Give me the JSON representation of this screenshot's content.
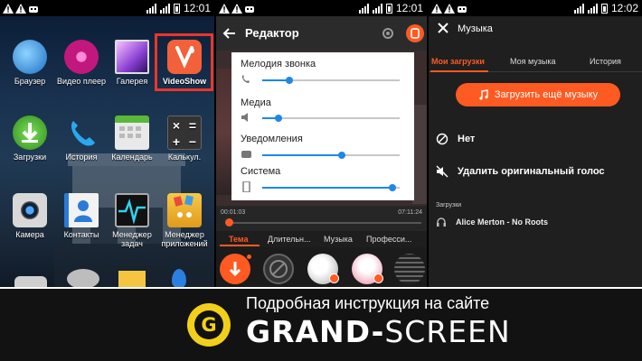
{
  "status_bars": [
    {
      "time": "12:01"
    },
    {
      "time": "12:01"
    },
    {
      "time": "12:02"
    }
  ],
  "launcher": {
    "apps": [
      {
        "label": "Браузер",
        "icon": "globe-icon"
      },
      {
        "label": "Видео плеер",
        "icon": "video-reel-icon"
      },
      {
        "label": "Галерея",
        "icon": "gallery-icon"
      },
      {
        "label": "VideoShow",
        "icon": "videoshow-icon"
      },
      {
        "label": "Загрузки",
        "icon": "download-icon"
      },
      {
        "label": "История",
        "icon": "phone-icon"
      },
      {
        "label": "Календарь",
        "icon": "calendar-icon"
      },
      {
        "label": "Калькул.",
        "icon": "calculator-icon"
      },
      {
        "label": "Камера",
        "icon": "camera-icon"
      },
      {
        "label": "Контакты",
        "icon": "contacts-icon"
      },
      {
        "label": "Менеджер задач",
        "icon": "task-manager-icon"
      },
      {
        "label": "Менеджер приложений",
        "icon": "app-manager-icon"
      }
    ],
    "highlight_color": "#e8372b"
  },
  "editor": {
    "title": "Редактор",
    "volume_rows": [
      {
        "label": "Мелодия звонка",
        "level": 0.2
      },
      {
        "label": "Медиа",
        "level": 0.12
      },
      {
        "label": "Уведомления",
        "level": 0.58
      },
      {
        "label": "Система",
        "level": 0.95
      }
    ],
    "time_start": "00:01:03",
    "time_end": "07:11:24",
    "tabs": [
      "Тема",
      "Длительн...",
      "Музыка",
      "Професси..."
    ],
    "active_tab": "Тема",
    "accent": "#ff5a22"
  },
  "music": {
    "title": "Музыка",
    "tabs": [
      "Мои загрузки",
      "Моя музыка",
      "История"
    ],
    "active_tab": "Мои загрузки",
    "load_button": "Загрузить ещё музыку",
    "option_none": "Нет",
    "option_remove_voice": "Удалить оригинальный голос",
    "downloads_header": "Загрузки",
    "song": "Alice Merton - No Roots"
  },
  "banner": {
    "subtitle": "Подробная инструкция на сайте",
    "brand_bold": "GRAND-",
    "brand_light": "SCREEN",
    "logo_letter": "G",
    "logo_color": "#f2d01a"
  }
}
